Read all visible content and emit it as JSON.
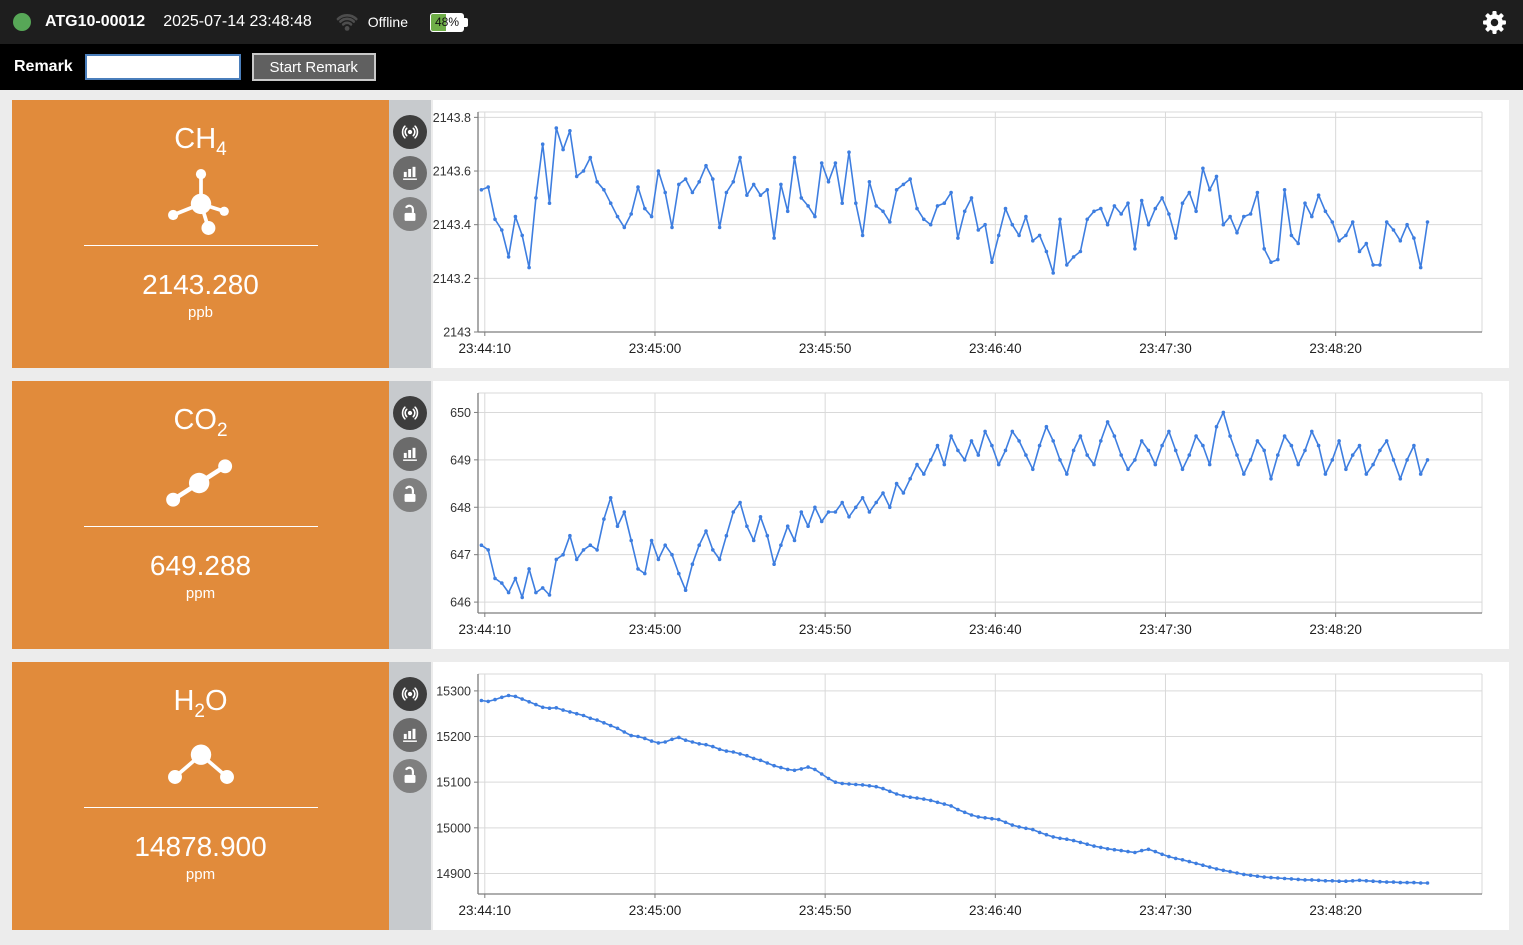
{
  "header": {
    "device_id": "ATG10-00012",
    "timestamp": "2025-07-14 23:48:48",
    "connection_status": "Offline",
    "battery_percent": "48%"
  },
  "remark_bar": {
    "label": "Remark",
    "input_value": "",
    "input_placeholder": "",
    "button_label": "Start Remark"
  },
  "colors": {
    "header_bg": "#1e1e1e",
    "status_green": "#57a757",
    "battery_green": "#6fae48",
    "accent_orange": "#e18b3b",
    "strip_bg": "#c7cacd",
    "line_blue": "#3e7ee0",
    "grid": "#d9d9d9",
    "axis": "#7d7d7d",
    "tick_text": "#333333"
  },
  "panels": [
    {
      "name": "CH4",
      "value": "2143.280",
      "unit": "ppb"
    },
    {
      "name": "CO2",
      "value": "649.288",
      "unit": "ppm"
    },
    {
      "name": "H2O",
      "value": "14878.900",
      "unit": "ppm"
    }
  ],
  "chart_data": [
    {
      "type": "line",
      "title": "CH4 concentration trend",
      "ylabel": "ppb",
      "legend": "none",
      "grid": true,
      "x_ticks": [
        "23:44:10",
        "23:45:00",
        "23:45:50",
        "23:46:40",
        "23:47:30",
        "23:48:20"
      ],
      "x_tick_offsets_s": [
        2,
        52,
        102,
        152,
        202,
        252
      ],
      "x_span_s": 295,
      "first_sample_offset_s": 1,
      "sample_interval_s": 2,
      "y_ticks": [
        2143,
        2143.2,
        2143.4,
        2143.6,
        2143.8
      ],
      "y_tick_labels": [
        "2143",
        "2143.2",
        "2143.4",
        "2143.6",
        "2143.8"
      ],
      "y_range": [
        2143.0,
        2143.82
      ],
      "values": [
        2143.53,
        2143.54,
        2143.42,
        2143.38,
        2143.28,
        2143.43,
        2143.36,
        2143.24,
        2143.5,
        2143.7,
        2143.48,
        2143.76,
        2143.68,
        2143.75,
        2143.58,
        2143.6,
        2143.65,
        2143.56,
        2143.53,
        2143.48,
        2143.43,
        2143.39,
        2143.44,
        2143.54,
        2143.46,
        2143.43,
        2143.6,
        2143.52,
        2143.39,
        2143.55,
        2143.57,
        2143.52,
        2143.56,
        2143.62,
        2143.57,
        2143.39,
        2143.52,
        2143.56,
        2143.65,
        2143.51,
        2143.55,
        2143.51,
        2143.53,
        2143.35,
        2143.55,
        2143.45,
        2143.65,
        2143.5,
        2143.47,
        2143.43,
        2143.63,
        2143.56,
        2143.63,
        2143.48,
        2143.67,
        2143.48,
        2143.36,
        2143.56,
        2143.47,
        2143.45,
        2143.41,
        2143.53,
        2143.55,
        2143.57,
        2143.46,
        2143.42,
        2143.4,
        2143.47,
        2143.48,
        2143.52,
        2143.35,
        2143.45,
        2143.5,
        2143.38,
        2143.4,
        2143.26,
        2143.36,
        2143.46,
        2143.4,
        2143.36,
        2143.43,
        2143.34,
        2143.36,
        2143.3,
        2143.22,
        2143.42,
        2143.25,
        2143.28,
        2143.3,
        2143.42,
        2143.45,
        2143.46,
        2143.4,
        2143.47,
        2143.44,
        2143.48,
        2143.31,
        2143.49,
        2143.4,
        2143.46,
        2143.5,
        2143.44,
        2143.35,
        2143.48,
        2143.52,
        2143.45,
        2143.61,
        2143.53,
        2143.58,
        2143.4,
        2143.43,
        2143.37,
        2143.43,
        2143.44,
        2143.52,
        2143.31,
        2143.26,
        2143.27,
        2143.53,
        2143.36,
        2143.33,
        2143.48,
        2143.43,
        2143.51,
        2143.45,
        2143.41,
        2143.34,
        2143.36,
        2143.41,
        2143.3,
        2143.33,
        2143.25,
        2143.25,
        2143.41,
        2143.38,
        2143.34,
        2143.4,
        2143.35,
        2143.24,
        2143.41
      ]
    },
    {
      "type": "line",
      "title": "CO2 concentration trend",
      "ylabel": "ppm",
      "legend": "none",
      "grid": true,
      "x_ticks": [
        "23:44:10",
        "23:45:00",
        "23:45:50",
        "23:46:40",
        "23:47:30",
        "23:48:20"
      ],
      "x_tick_offsets_s": [
        2,
        52,
        102,
        152,
        202,
        252
      ],
      "x_span_s": 295,
      "first_sample_offset_s": 1,
      "sample_interval_s": 2,
      "y_ticks": [
        646,
        647,
        648,
        649,
        650
      ],
      "y_tick_labels": [
        "646",
        "647",
        "648",
        "649",
        "650"
      ],
      "y_range": [
        645.77,
        650.41
      ],
      "values": [
        647.2,
        647.1,
        646.5,
        646.4,
        646.2,
        646.5,
        646.1,
        646.7,
        646.2,
        646.3,
        646.15,
        646.9,
        647.0,
        647.4,
        646.9,
        647.1,
        647.2,
        647.1,
        647.75,
        648.2,
        647.6,
        647.9,
        647.3,
        646.7,
        646.6,
        647.3,
        646.9,
        647.2,
        647.0,
        646.6,
        646.25,
        646.8,
        647.2,
        647.5,
        647.1,
        646.9,
        647.4,
        647.9,
        648.1,
        647.6,
        647.3,
        647.8,
        647.4,
        646.8,
        647.2,
        647.6,
        647.3,
        647.9,
        647.6,
        648.0,
        647.7,
        647.9,
        647.9,
        648.1,
        647.8,
        648.0,
        648.2,
        647.9,
        648.1,
        648.3,
        648.0,
        648.5,
        648.3,
        648.6,
        648.9,
        648.7,
        649.0,
        649.3,
        648.9,
        649.5,
        649.2,
        649.0,
        649.4,
        649.1,
        649.6,
        649.3,
        648.9,
        649.2,
        649.6,
        649.4,
        649.1,
        648.8,
        649.3,
        649.7,
        649.4,
        649.0,
        648.7,
        649.2,
        649.5,
        649.1,
        648.9,
        649.4,
        649.8,
        649.5,
        649.1,
        648.8,
        649.0,
        649.4,
        649.2,
        648.9,
        649.3,
        649.6,
        649.2,
        648.8,
        649.1,
        649.5,
        649.3,
        648.9,
        649.7,
        650.0,
        649.5,
        649.1,
        648.7,
        649.0,
        649.4,
        649.2,
        648.6,
        649.1,
        649.5,
        649.3,
        648.9,
        649.2,
        649.6,
        649.3,
        648.7,
        649.0,
        649.4,
        648.8,
        649.1,
        649.3,
        648.7,
        648.9,
        649.2,
        649.4,
        649.0,
        648.6,
        649.0,
        649.3,
        648.7,
        649.0
      ]
    },
    {
      "type": "line",
      "title": "H2O concentration trend",
      "ylabel": "ppm",
      "legend": "none",
      "grid": true,
      "x_ticks": [
        "23:44:10",
        "23:45:00",
        "23:45:50",
        "23:46:40",
        "23:47:30",
        "23:48:20"
      ],
      "x_tick_offsets_s": [
        2,
        52,
        102,
        152,
        202,
        252
      ],
      "x_span_s": 295,
      "first_sample_offset_s": 1,
      "sample_interval_s": 2,
      "y_ticks": [
        14900,
        15000,
        15100,
        15200,
        15300
      ],
      "y_tick_labels": [
        "14900",
        "15000",
        "15100",
        "15200",
        "15300"
      ],
      "y_range": [
        14855,
        15337
      ],
      "values": [
        15279,
        15277,
        15281,
        15286,
        15290,
        15288,
        15282,
        15276,
        15270,
        15264,
        15262,
        15263,
        15258,
        15254,
        15250,
        15246,
        15240,
        15236,
        15230,
        15224,
        15218,
        15210,
        15202,
        15200,
        15196,
        15190,
        15186,
        15188,
        15194,
        15198,
        15192,
        15188,
        15184,
        15182,
        15178,
        15172,
        15168,
        15166,
        15162,
        15158,
        15152,
        15148,
        15142,
        15136,
        15132,
        15128,
        15126,
        15129,
        15133,
        15128,
        15118,
        15108,
        15100,
        15097,
        15096,
        15095,
        15094,
        15092,
        15090,
        15086,
        15080,
        15074,
        15070,
        15067,
        15065,
        15063,
        15060,
        15056,
        15052,
        15048,
        15040,
        15034,
        15028,
        15024,
        15022,
        15020,
        15018,
        15012,
        15006,
        15002,
        14999,
        14996,
        14990,
        14985,
        14980,
        14977,
        14975,
        14972,
        14968,
        14964,
        14960,
        14957,
        14954,
        14952,
        14950,
        14948,
        14946,
        14950,
        14953,
        14948,
        14942,
        14937,
        14933,
        14930,
        14926,
        14922,
        14918,
        14914,
        14910,
        14907,
        14904,
        14901,
        14898,
        14896,
        14894,
        14892,
        14891,
        14890,
        14889,
        14888,
        14887,
        14886,
        14886,
        14885,
        14884,
        14884,
        14883,
        14883,
        14884,
        14885,
        14884,
        14883,
        14882,
        14881,
        14881,
        14880,
        14880,
        14880,
        14879,
        14879
      ]
    }
  ]
}
